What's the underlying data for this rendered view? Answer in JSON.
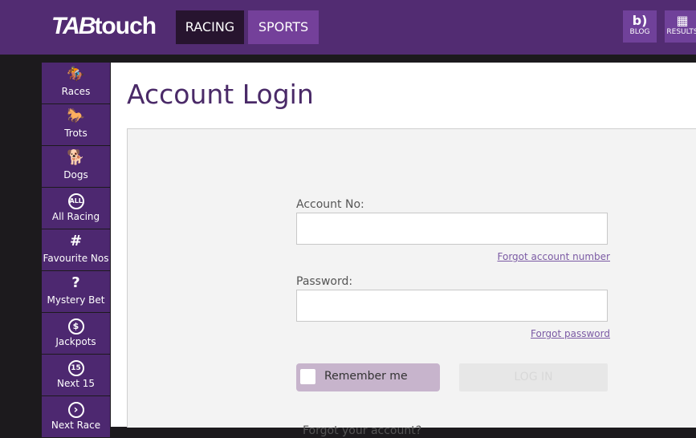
{
  "header": {
    "logo": {
      "part1": "TAB",
      "part2": "touch"
    },
    "nav": [
      {
        "label": "RACING",
        "active": true
      },
      {
        "label": "SPORTS",
        "active": false
      }
    ],
    "buttons": [
      {
        "label": "BLOG",
        "icon": "blog-icon"
      },
      {
        "label": "RESULTS",
        "icon": "checkered-flag-icon"
      }
    ]
  },
  "sidebar": {
    "items": [
      {
        "label": "Races",
        "icon": "horse-racing-icon",
        "glyph": "🏇"
      },
      {
        "label": "Trots",
        "icon": "harness-racing-icon",
        "glyph": "🐎"
      },
      {
        "label": "Dogs",
        "icon": "greyhound-icon",
        "glyph": "🐕"
      },
      {
        "label": "All Racing",
        "icon": "all-circle-icon",
        "glyph": "ALL"
      },
      {
        "label": "Favourite Nos",
        "icon": "hash-icon",
        "glyph": "#"
      },
      {
        "label": "Mystery Bet",
        "icon": "question-icon",
        "glyph": "?"
      },
      {
        "label": "Jackpots",
        "icon": "dollar-circle-icon",
        "glyph": "$"
      },
      {
        "label": "Next 15",
        "icon": "fifteen-circle-icon",
        "glyph": "15"
      },
      {
        "label": "Next Race",
        "icon": "chevron-right-circle-icon",
        "glyph": "›"
      }
    ]
  },
  "main": {
    "title": "Account Login",
    "account": {
      "label": "Account No:",
      "value": "",
      "forgot": "Forgot account number"
    },
    "password": {
      "label": "Password:",
      "value": "",
      "forgot": "Forgot password"
    },
    "remember_label": "Remember me",
    "login_label": "LOG IN",
    "bottom_text": "Forgot your account?"
  },
  "colors": {
    "header": "#522c72",
    "sidebar": "#4d2870",
    "title": "#4a2a68",
    "link": "#7b5aa4"
  }
}
